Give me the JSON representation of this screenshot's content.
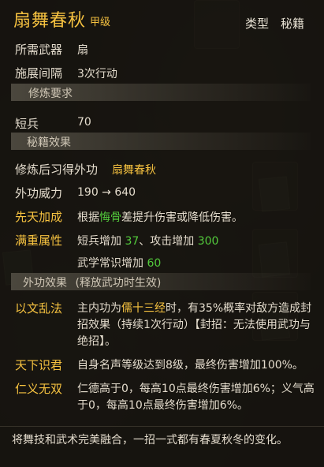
{
  "tooltip": {
    "title": "扇舞春秋",
    "grade": "甲级",
    "type_label": "类型",
    "type_value": "秘籍",
    "weapon_label": "所需武器",
    "weapon_value": "扇",
    "interval_label": "施展间隔",
    "interval_value": "3次行动",
    "section_requirement": "修炼要求",
    "req_label": "短兵",
    "req_value": "70",
    "section_effect": "秘籍效果",
    "learn_label": "修炼后习得外功",
    "learn_value": "扇舞春秋",
    "power_label": "外功威力",
    "power_value": "190 → 640",
    "innate_label": "先天加成",
    "innate_pre": "根据",
    "innate_highlight": "悔骨",
    "innate_post": "差提升伤害或降低伤害。",
    "fullweight_label": "满重属性",
    "fullweight_1_pre": "短兵增加",
    "fullweight_1_val": "37",
    "fullweight_1_mid": "、攻击增加",
    "fullweight_1_val2": "300",
    "fullweight_2_pre": "武学常识增加",
    "fullweight_2_val": "60",
    "section_external": "外功效果",
    "section_external_note": "(释放武功时生效)",
    "skill1_label": "以文乱法",
    "skill1_pre": "主内功为",
    "skill1_highlight": "儒十三经",
    "skill1_post": "时，有35%概率对敌方造成封招效果（持续1次行动）【封招：无法使用武功与绝招】。",
    "skill2_label": "天下识君",
    "skill2_text": "自身名声等级达到8级，最终伤害增加100%。",
    "skill3_label": "仁义无双",
    "skill3_text": "仁德高于0，每高10点最终伤害增加6%；义气高于0，每高10点最终伤害增加6%。",
    "footer": "将舞技和武术完美融合，一招一式都有春夏秋冬的变化。"
  }
}
